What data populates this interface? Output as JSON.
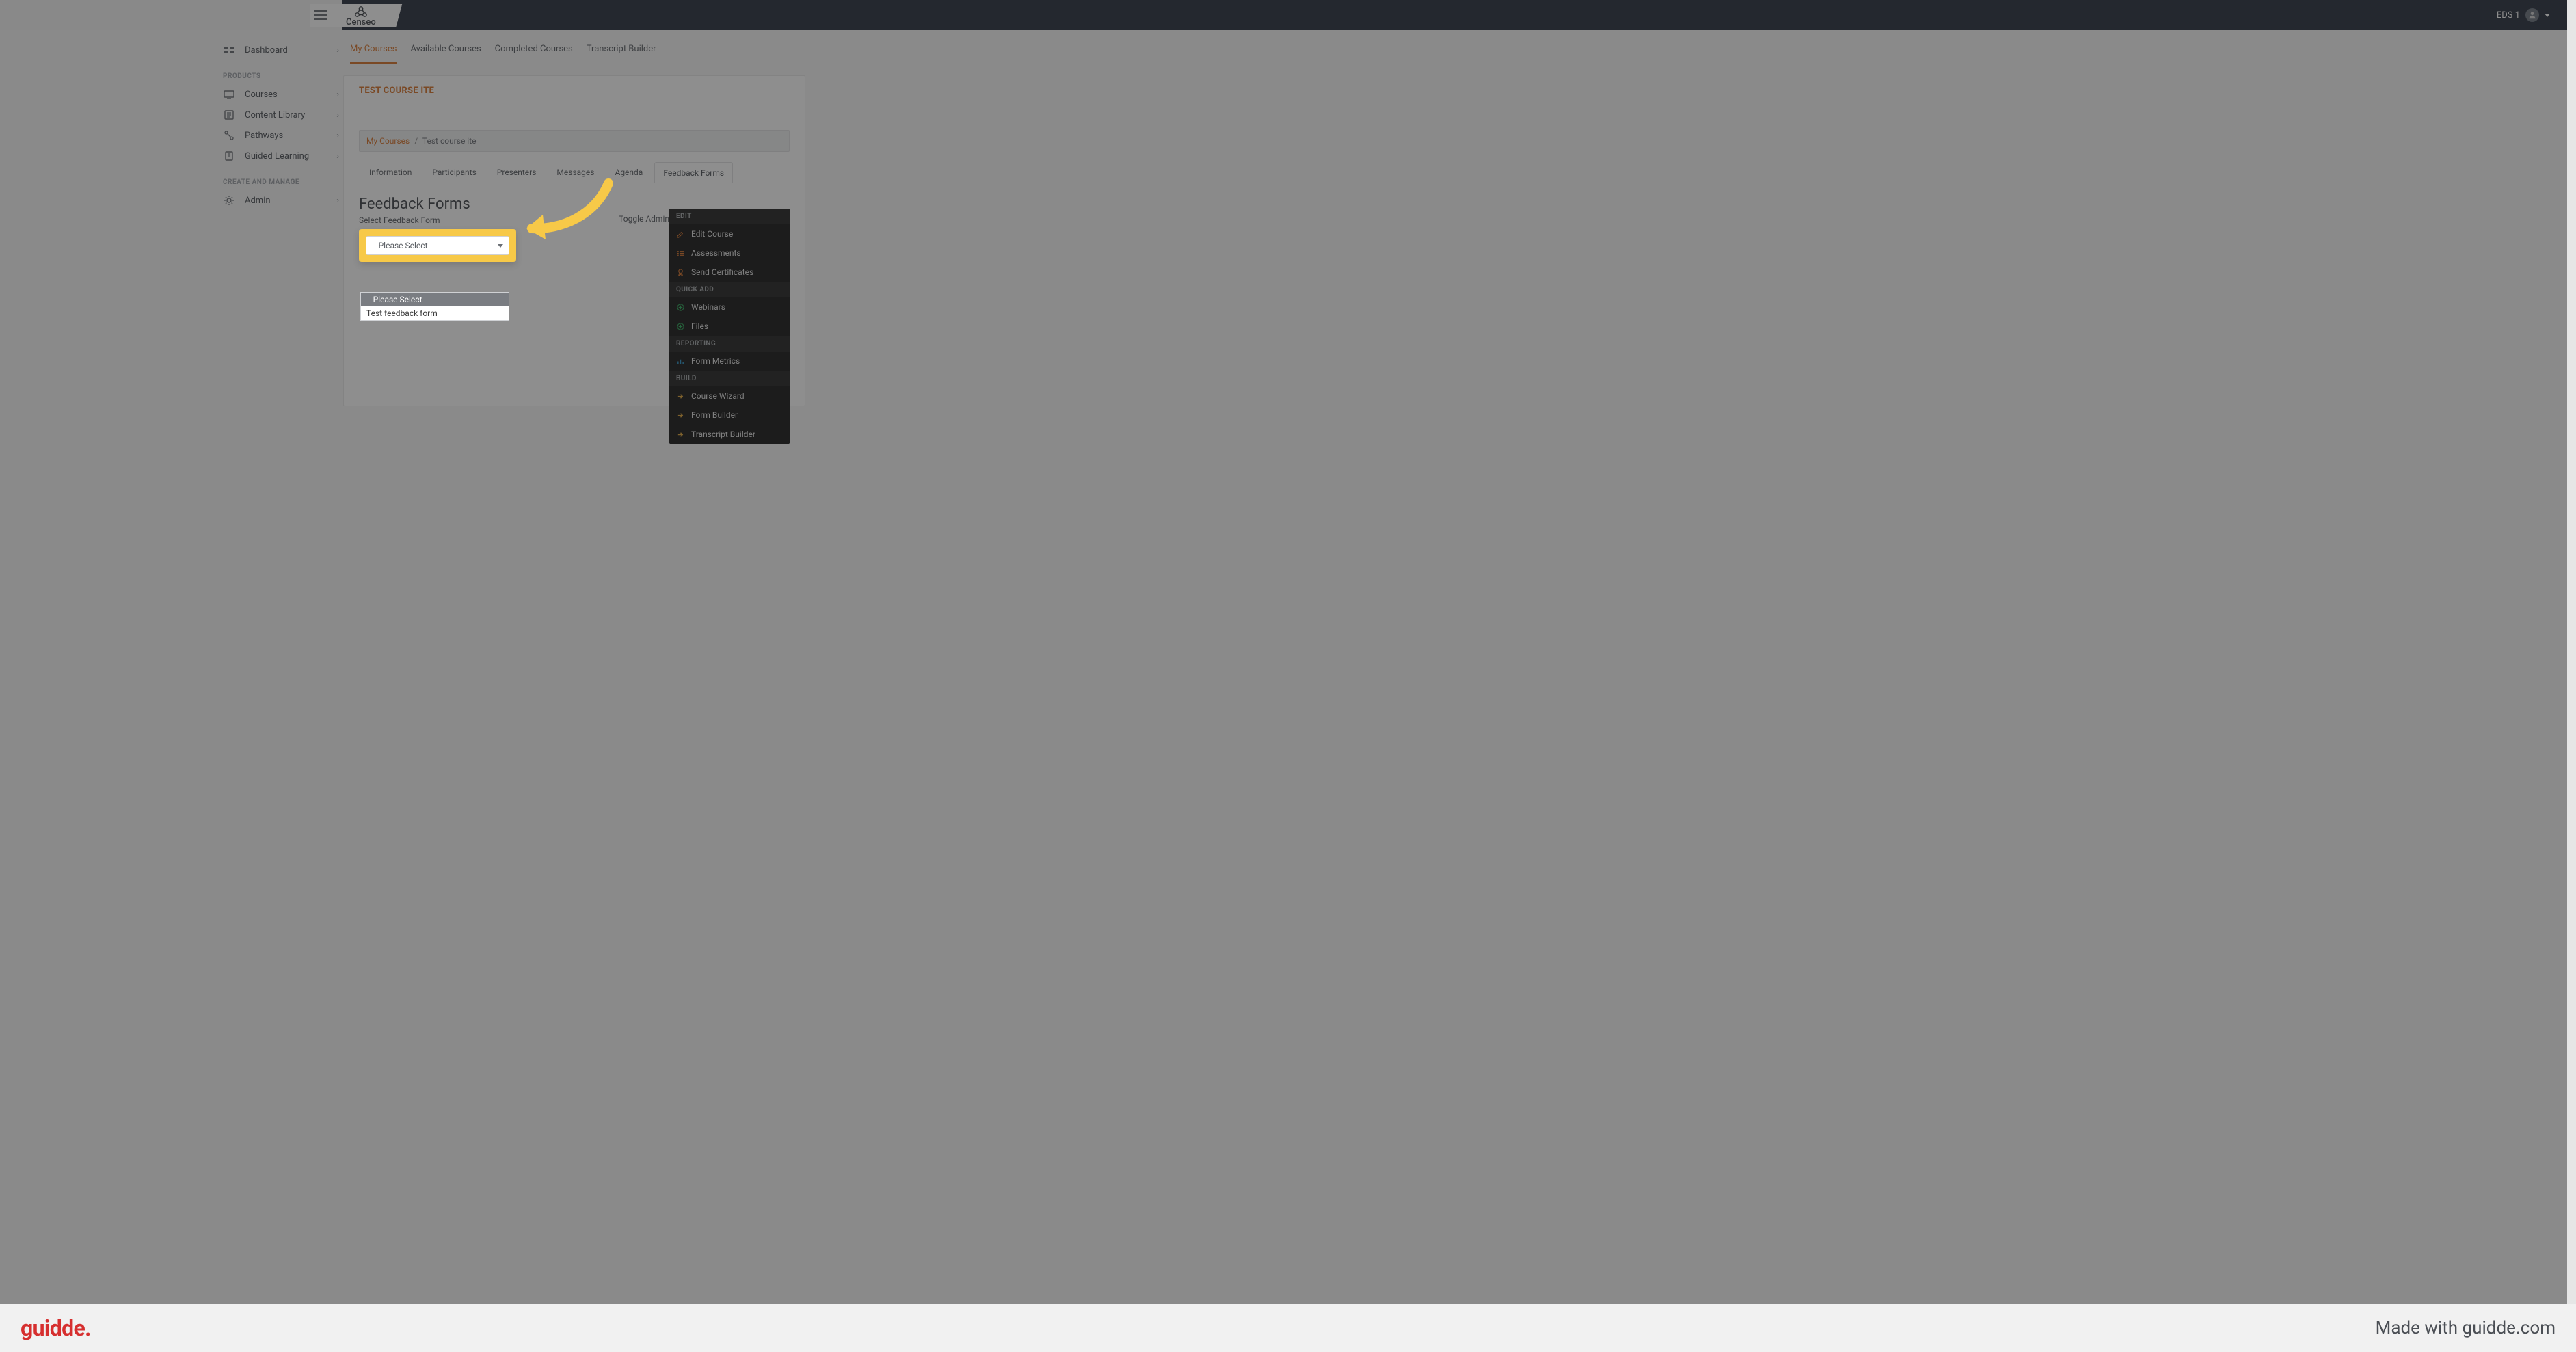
{
  "header": {
    "logo_text": "Censeo",
    "user_name": "EDS 1"
  },
  "sidebar": {
    "items_top": [
      {
        "icon": "dashboard",
        "label": "Dashboard"
      }
    ],
    "section_products": "PRODUCTS",
    "items_products": [
      {
        "icon": "courses",
        "label": "Courses"
      },
      {
        "icon": "library",
        "label": "Content Library"
      },
      {
        "icon": "pathways",
        "label": "Pathways"
      },
      {
        "icon": "guided",
        "label": "Guided Learning"
      }
    ],
    "section_manage": "CREATE AND MANAGE",
    "items_manage": [
      {
        "icon": "admin",
        "label": "Admin"
      }
    ]
  },
  "top_tabs": [
    {
      "label": "My Courses",
      "active": true
    },
    {
      "label": "Available Courses",
      "active": false
    },
    {
      "label": "Completed Courses",
      "active": false
    },
    {
      "label": "Transcript Builder",
      "active": false
    }
  ],
  "course": {
    "title": "TEST COURSE ITE",
    "breadcrumb_root": "My Courses",
    "breadcrumb_current": "Test course ite"
  },
  "section_tabs": [
    {
      "label": "Information",
      "active": false
    },
    {
      "label": "Participants",
      "active": false
    },
    {
      "label": "Presenters",
      "active": false
    },
    {
      "label": "Messages",
      "active": false
    },
    {
      "label": "Agenda",
      "active": false
    },
    {
      "label": "Feedback Forms",
      "active": true
    }
  ],
  "toggle_admin_label": "Toggle Admin",
  "admin_panel": {
    "sections": [
      {
        "heading": "EDIT",
        "items": [
          {
            "label": "Edit Course",
            "color": "orange",
            "icon": "edit"
          },
          {
            "label": "Assessments",
            "color": "orange",
            "icon": "check"
          },
          {
            "label": "Send Certificates",
            "color": "orange",
            "icon": "cert"
          }
        ]
      },
      {
        "heading": "QUICK ADD",
        "items": [
          {
            "label": "Webinars",
            "color": "green",
            "icon": "plus"
          },
          {
            "label": "Files",
            "color": "green",
            "icon": "plus"
          }
        ]
      },
      {
        "heading": "REPORTING",
        "items": [
          {
            "label": "Form Metrics",
            "color": "blue",
            "icon": "metrics"
          }
        ]
      },
      {
        "heading": "BUILD",
        "items": [
          {
            "label": "Course Wizard",
            "color": "yellow",
            "icon": "arrow"
          },
          {
            "label": "Form Builder",
            "color": "yellow",
            "icon": "arrow"
          },
          {
            "label": "Transcript Builder",
            "color": "yellow",
            "icon": "arrow"
          }
        ]
      }
    ]
  },
  "page": {
    "heading": "Feedback Forms",
    "field_label": "Select Feedback Form",
    "select_value": "-- Please Select --",
    "dropdown_options": [
      "-- Please Select --",
      "Test feedback form"
    ]
  },
  "footer": {
    "logo": "guidde.",
    "tagline": "Made with guidde.com"
  }
}
